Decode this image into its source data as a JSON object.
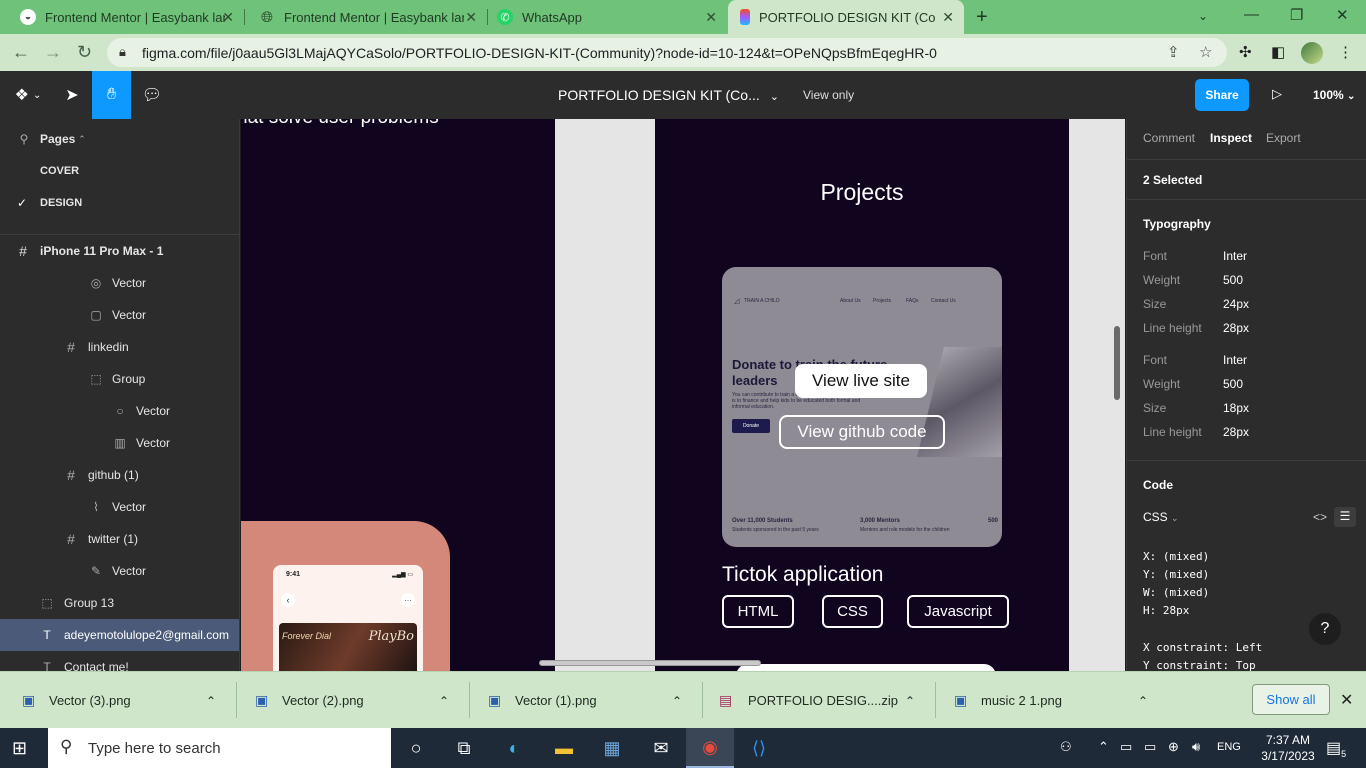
{
  "browser": {
    "tabs": [
      {
        "title": "Frontend Mentor | Easybank landi",
        "icon": "frontend-mentor-icon",
        "active": false
      },
      {
        "title": "Frontend Mentor | Easybank landi",
        "icon": "globe-icon",
        "active": false
      },
      {
        "title": "WhatsApp",
        "icon": "whatsapp-icon",
        "active": false
      },
      {
        "title": "PORTFOLIO DESIGN KIT (Commu",
        "icon": "figma-icon",
        "active": true
      }
    ],
    "url": "figma.com/file/j0aau5Gl3LMajAQYCaSolo/PORTFOLIO-DESIGN-KIT-(Community)?node-id=10-124&t=OPeNQpsBfmEqegHR-0",
    "accent": "#6fc27a"
  },
  "figma": {
    "doc_title": "PORTFOLIO DESIGN KIT (Co...",
    "view_only": "View only",
    "share": "Share",
    "zoom": "100%",
    "pages_label": "Pages",
    "pages": [
      "COVER",
      "DESIGN"
    ],
    "layers": [
      {
        "label": "iPhone 11 Pro Max - 1",
        "icon": "#"
      },
      {
        "label": "Vector",
        "icon": "◎"
      },
      {
        "label": "Vector",
        "icon": "▢"
      },
      {
        "label": "linkedin",
        "icon": "#"
      },
      {
        "label": "Group",
        "icon": "⬚"
      },
      {
        "label": "Vector",
        "icon": "○"
      },
      {
        "label": "Vector",
        "icon": "▥"
      },
      {
        "label": "github (1)",
        "icon": "#"
      },
      {
        "label": "Vector",
        "icon": "⌇"
      },
      {
        "label": "twitter (1)",
        "icon": "#"
      },
      {
        "label": "Vector",
        "icon": "✎"
      },
      {
        "label": "Group 13",
        "icon": "⬚"
      },
      {
        "label": "adeyemotolulope2@gmail.com",
        "icon": "T"
      },
      {
        "label": "Contact me!",
        "icon": "T"
      }
    ],
    "canvas": {
      "left_text": "hat solve user problems",
      "phone_time": "9:41",
      "cover_t1": "Forever Dial",
      "cover_t2": "PlayBo",
      "projects_title": "Projects",
      "card": {
        "brand": "TRAIN A CHILD",
        "nav": [
          "About Us",
          "Projects",
          "FAQs",
          "Contact Us"
        ],
        "hero": "Donate to train the future leaders",
        "body": "You can contribute to train a child. We are an NGO whose goal is to finance and help kids to be educated both formal and informal education.",
        "donate": "Donate",
        "stat1": "Over 11,000 Students",
        "stat1_sub": "Students sponsored in the past 5 years",
        "stat2": "3,000 Mentors",
        "stat2_sub": "Mentors and role models for the children",
        "stat3": "500"
      },
      "live_site": "View live site",
      "github_code": "View github code",
      "tiktok_title": "Tictok application",
      "tags": [
        "HTML",
        "CSS",
        "Javascript"
      ]
    },
    "inspect": {
      "tabs": [
        "Comment",
        "Inspect",
        "Export"
      ],
      "selected": "2 Selected",
      "typography_label": "Typography",
      "typo1": {
        "font": "Inter",
        "weight": "500",
        "size": "24px",
        "line_height": "28px"
      },
      "typo2": {
        "font": "Inter",
        "weight": "500",
        "size": "18px",
        "line_height": "28px"
      },
      "labels": {
        "font": "Font",
        "weight": "Weight",
        "size": "Size",
        "line_height": "Line height"
      },
      "code_label": "Code",
      "code_lang": "CSS",
      "code_lines": [
        "X: (mixed)",
        "Y: (mixed)",
        "W: (mixed)",
        "H: 28px"
      ],
      "constraints": [
        "X constraint: Left",
        "Y constraint: Top"
      ]
    }
  },
  "downloads": [
    {
      "name": "Vector (3).png"
    },
    {
      "name": "Vector (2).png"
    },
    {
      "name": "Vector (1).png"
    },
    {
      "name": "PORTFOLIO DESIG....zip"
    },
    {
      "name": "music 2 1.png"
    }
  ],
  "downloads_show_all": "Show all",
  "taskbar": {
    "search_placeholder": "Type here to search",
    "lang": "ENG",
    "time": "7:37 AM",
    "date": "3/17/2023",
    "notif_count": "5"
  }
}
